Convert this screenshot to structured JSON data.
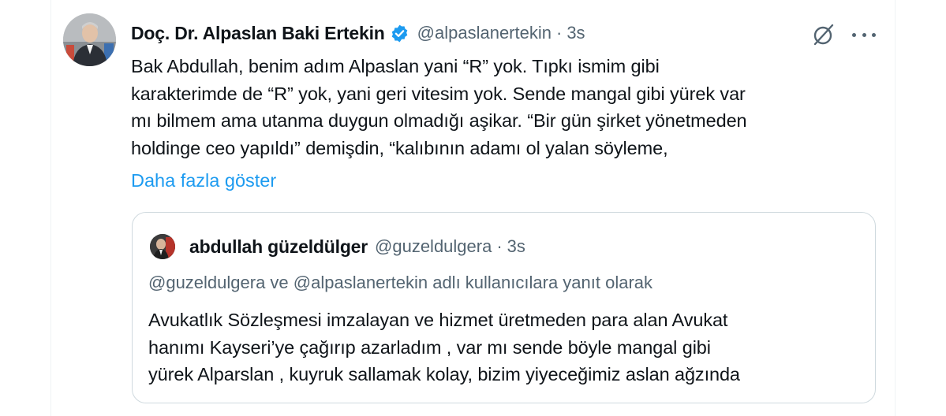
{
  "tweet": {
    "author_name": "Doç. Dr. Alpaslan Baki Ertekin",
    "handle": "@alpaslanertekin",
    "separator": "·",
    "time": "3s",
    "text": "Bak Abdullah, benim adım Alpaslan yani “R” yok. Tıpkı ismim gibi\nkarakterimde de “R” yok, yani geri vitesim yok. Sende mangal gibi yürek var\nmı bilmem ama utanma duygun olmadığı aşikar. “Bir gün şirket yönetmeden\nholdinge ceo yapıldı” demişdin, “kalıbının adamı ol yalan söyleme,",
    "show_more": "Daha fazla göster"
  },
  "quoted": {
    "author_name": "abdullah güzeldülger",
    "handle": "@guzeldulgera",
    "separator": "·",
    "time": "3s",
    "reply_to": "@guzeldulgera ve @alpaslanertekin adlı kullanıcılara yanıt olarak",
    "text": "Avukatlık Sözleşmesi imzalayan ve hizmet üretmeden para alan Avukat\nhanımı Kayseri’ye çağırıp azarladım , var mı sende böyle mangal gibi\nyürek Alparslan , kuyruk sallamak kolay, bizim yiyeceğimiz aslan ağzında"
  },
  "colors": {
    "accent": "#1d9bf0",
    "secondary_text": "#536471",
    "border": "#cfd9de"
  },
  "icons": {
    "verified": "verified-badge-icon",
    "grok": "grok-icon",
    "more": "more-options-icon"
  }
}
